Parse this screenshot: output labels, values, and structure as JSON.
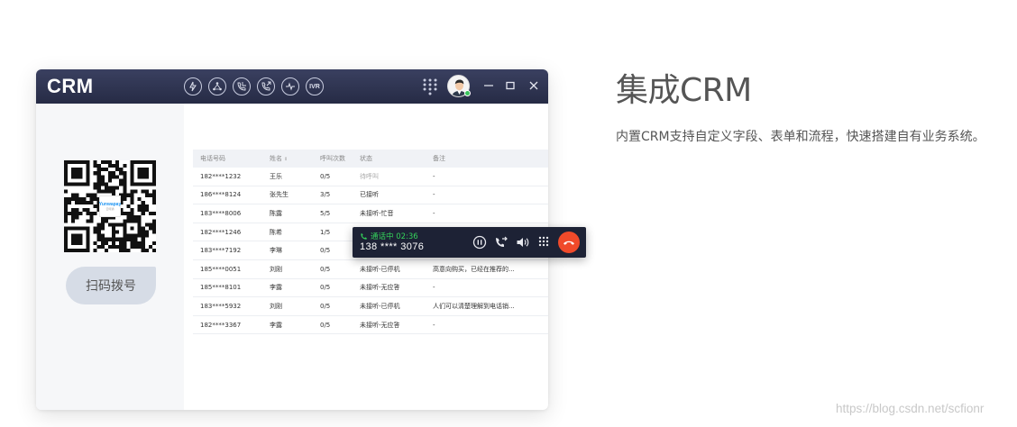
{
  "window": {
    "title": "CRM",
    "toolbar_icons": [
      "dial-icon",
      "transfer-icon",
      "phone-in-icon",
      "phone-out-icon",
      "pulse-icon",
      "ivr-icon"
    ],
    "ivr_label": "IVR",
    "controls": [
      "minimize-icon",
      "maximize-icon",
      "close-icon"
    ]
  },
  "left_panel": {
    "qr_logo_line1": "Yunwapay",
    "qr_logo_line2": "云呼通",
    "scan_button_label": "扫码拨号"
  },
  "table": {
    "columns": [
      "电话号码",
      "姓名",
      "呼叫次数",
      "状态",
      "备注"
    ],
    "rows": [
      [
        "182****1232",
        "王乐",
        "0/5",
        "待呼叫",
        "-"
      ],
      [
        "186****8124",
        "张先生",
        "3/5",
        "已接听",
        "-"
      ],
      [
        "183****8006",
        "陈露",
        "5/5",
        "未接听-忙音",
        "-"
      ],
      [
        "182****1246",
        "陈希",
        "1/5",
        "",
        ""
      ],
      [
        "183****7192",
        "李琳",
        "0/5",
        "",
        ""
      ],
      [
        "185****0051",
        "刘刚",
        "0/5",
        "未接听-已停机",
        "高意向购买，已经在推荐的..."
      ],
      [
        "185****8101",
        "李露",
        "0/5",
        "未接听-无应答",
        "-"
      ],
      [
        "183****5932",
        "刘刚",
        "0/5",
        "未接听-已停机",
        "人们可以清楚理解到电话销..."
      ],
      [
        "182****3367",
        "李露",
        "0/5",
        "未接听-无应答",
        "-"
      ]
    ]
  },
  "call_bar": {
    "status": "通话中 02:36",
    "number": "138 **** 3076",
    "icons": [
      "pause-icon",
      "transfer-call-icon",
      "volume-icon",
      "keypad-icon",
      "hangup-icon"
    ]
  },
  "feature": {
    "heading": "集成CRM",
    "description": "内置CRM支持自定义字段、表单和流程，快速搭建自有业务系统。"
  },
  "watermark": "https://blog.csdn.net/scfionr",
  "colors": {
    "titlebar": "#262b45",
    "call_green": "#34d15a",
    "hangup_red": "#f04a2a",
    "scan_button": "#d6dce6"
  }
}
